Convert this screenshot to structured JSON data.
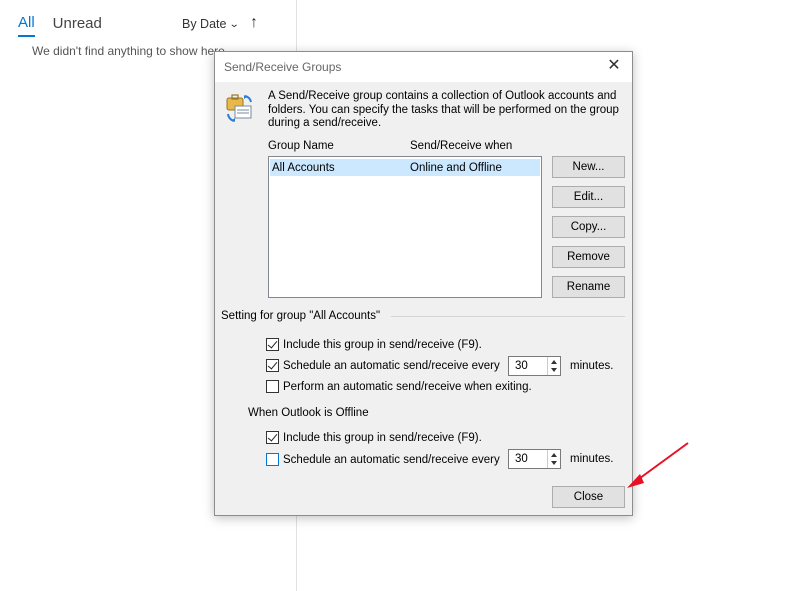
{
  "mail_pane": {
    "tab_all": "All",
    "tab_unread": "Unread",
    "sort_label": "By Date",
    "sort_direction": "↑",
    "empty_message": "We didn't find anything to show here."
  },
  "dialog": {
    "title": "Send/Receive Groups",
    "close_symbol": "✕",
    "intro": "A Send/Receive group contains a collection of Outlook accounts and folders. You can specify the tasks that will be performed on the group during a send/receive.",
    "col_group_name": "Group Name",
    "col_when": "Send/Receive when",
    "groups": [
      {
        "name": "All Accounts",
        "when": "Online and Offline",
        "selected": true
      }
    ],
    "buttons": {
      "new": "New...",
      "edit": "Edit...",
      "copy": "Copy...",
      "remove": "Remove",
      "rename": "Rename",
      "close": "Close"
    },
    "setting_label": "Setting for group \"All Accounts\"",
    "online": {
      "include": {
        "label": "Include this group in send/receive (F9).",
        "checked": true
      },
      "schedule": {
        "label": "Schedule an automatic send/receive every",
        "checked": true,
        "value": "30",
        "unit": "minutes."
      },
      "exiting": {
        "label": "Perform an automatic send/receive when exiting.",
        "checked": false
      }
    },
    "offline_label": "When Outlook is Offline",
    "offline": {
      "include": {
        "label": "Include this group in send/receive (F9).",
        "checked": true
      },
      "schedule": {
        "label": "Schedule an automatic send/receive every",
        "checked": false,
        "value": "30",
        "unit": "minutes."
      }
    }
  },
  "colors": {
    "accent": "#0078d4",
    "selection": "#cce8ff",
    "annotation": "#e81123"
  },
  "icons": [
    "send-receive-groups-icon",
    "close-icon",
    "chevron-down-icon",
    "sort-arrow-icon",
    "checkmark-icon",
    "spin-up-icon",
    "spin-down-icon",
    "red-annotation-arrow"
  ]
}
